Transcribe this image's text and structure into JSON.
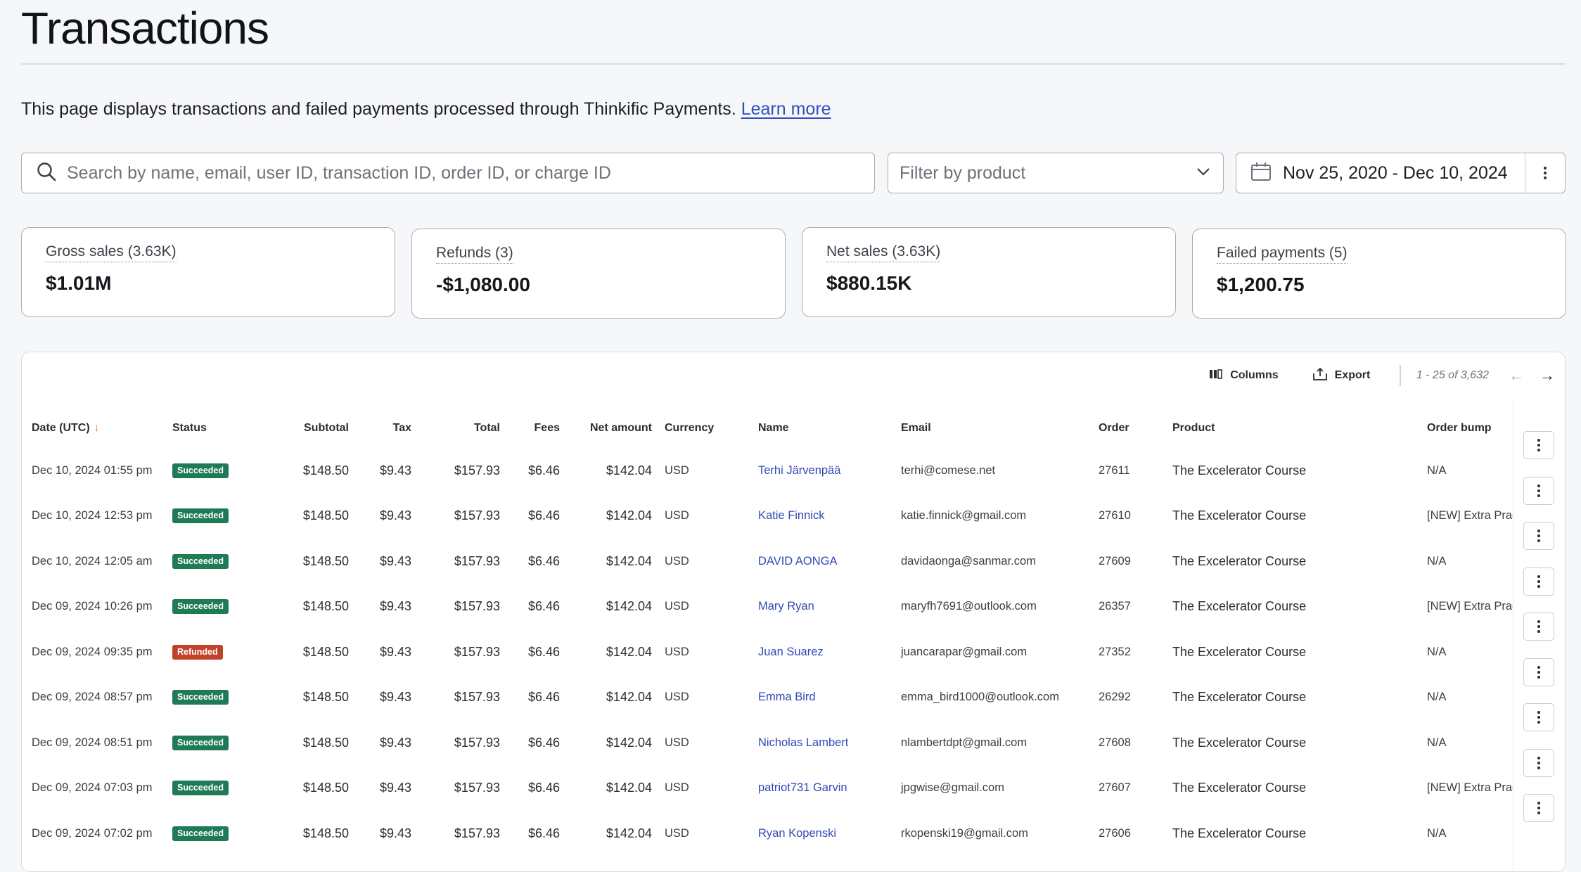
{
  "header": {
    "title": "Transactions"
  },
  "intro": {
    "text": "This page displays transactions and failed payments processed through Thinkific Payments.",
    "link": "Learn more"
  },
  "filters": {
    "search_placeholder": "Search by name, email, user ID, transaction ID, order ID, or charge ID",
    "product_placeholder": "Filter by product",
    "date_range": "Nov 25, 2020 - Dec 10, 2024"
  },
  "stats": [
    {
      "label": "Gross sales (3.63K)",
      "value": "$1.01M"
    },
    {
      "label": "Refunds (3)",
      "value": "-$1,080.00"
    },
    {
      "label": "Net sales (3.63K)",
      "value": "$880.15K"
    },
    {
      "label": "Failed payments (5)",
      "value": "$1,200.75"
    }
  ],
  "toolbar": {
    "columns_label": "Columns",
    "export_label": "Export",
    "pagination": "1 - 25 of 3,632"
  },
  "colors": {
    "succeeded": "#1f7a56",
    "refunded": "#c2412a",
    "link": "#3149b5",
    "sort_arrow": "#e07a2e"
  },
  "table": {
    "headers": {
      "date": "Date (UTC)",
      "status": "Status",
      "subtotal": "Subtotal",
      "tax": "Tax",
      "total": "Total",
      "fees": "Fees",
      "net": "Net amount",
      "currency": "Currency",
      "name": "Name",
      "email": "Email",
      "order": "Order",
      "product": "Product",
      "bump": "Order bump"
    },
    "rows": [
      {
        "date": "Dec 10, 2024 01:55 pm",
        "status": "Succeeded",
        "subtotal": "$148.50",
        "tax": "$9.43",
        "total": "$157.93",
        "fees": "$6.46",
        "net": "$142.04",
        "currency": "USD",
        "name": "Terhi Järvenpää",
        "email": "terhi@comese.net",
        "order": "27611",
        "product": "The Excelerator Course",
        "bump": "N/A"
      },
      {
        "date": "Dec 10, 2024 12:53 pm",
        "status": "Succeeded",
        "subtotal": "$148.50",
        "tax": "$9.43",
        "total": "$157.93",
        "fees": "$6.46",
        "net": "$142.04",
        "currency": "USD",
        "name": "Katie Finnick",
        "email": "katie.finnick@gmail.com",
        "order": "27610",
        "product": "The Excelerator Course",
        "bump": "[NEW] Extra Practice"
      },
      {
        "date": "Dec 10, 2024 12:05 am",
        "status": "Succeeded",
        "subtotal": "$148.50",
        "tax": "$9.43",
        "total": "$157.93",
        "fees": "$6.46",
        "net": "$142.04",
        "currency": "USD",
        "name": "DAVID AONGA",
        "email": "davidaonga@sanmar.com",
        "order": "27609",
        "product": "The Excelerator Course",
        "bump": "N/A"
      },
      {
        "date": "Dec 09, 2024 10:26 pm",
        "status": "Succeeded",
        "subtotal": "$148.50",
        "tax": "$9.43",
        "total": "$157.93",
        "fees": "$6.46",
        "net": "$142.04",
        "currency": "USD",
        "name": "Mary Ryan",
        "email": "maryfh7691@outlook.com",
        "order": "26357",
        "product": "The Excelerator Course",
        "bump": "[NEW] Extra Practice"
      },
      {
        "date": "Dec 09, 2024 09:35 pm",
        "status": "Refunded",
        "subtotal": "$148.50",
        "tax": "$9.43",
        "total": "$157.93",
        "fees": "$6.46",
        "net": "$142.04",
        "currency": "USD",
        "name": "Juan Suarez",
        "email": "juancarapar@gmail.com",
        "order": "27352",
        "product": "The Excelerator Course",
        "bump": "N/A"
      },
      {
        "date": "Dec 09, 2024 08:57 pm",
        "status": "Succeeded",
        "subtotal": "$148.50",
        "tax": "$9.43",
        "total": "$157.93",
        "fees": "$6.46",
        "net": "$142.04",
        "currency": "USD",
        "name": "Emma Bird",
        "email": "emma_bird1000@outlook.com",
        "order": "26292",
        "product": "The Excelerator Course",
        "bump": "N/A"
      },
      {
        "date": "Dec 09, 2024 08:51 pm",
        "status": "Succeeded",
        "subtotal": "$148.50",
        "tax": "$9.43",
        "total": "$157.93",
        "fees": "$6.46",
        "net": "$142.04",
        "currency": "USD",
        "name": "Nicholas Lambert",
        "email": "nlambertdpt@gmail.com",
        "order": "27608",
        "product": "The Excelerator Course",
        "bump": "N/A"
      },
      {
        "date": "Dec 09, 2024 07:03 pm",
        "status": "Succeeded",
        "subtotal": "$148.50",
        "tax": "$9.43",
        "total": "$157.93",
        "fees": "$6.46",
        "net": "$142.04",
        "currency": "USD",
        "name": "patriot731 Garvin",
        "email": "jpgwise@gmail.com",
        "order": "27607",
        "product": "The Excelerator Course",
        "bump": "[NEW] Extra Practice"
      },
      {
        "date": "Dec 09, 2024 07:02 pm",
        "status": "Succeeded",
        "subtotal": "$148.50",
        "tax": "$9.43",
        "total": "$157.93",
        "fees": "$6.46",
        "net": "$142.04",
        "currency": "USD",
        "name": "Ryan Kopenski",
        "email": "rkopenski19@gmail.com",
        "order": "27606",
        "product": "The Excelerator Course",
        "bump": "N/A"
      }
    ]
  }
}
